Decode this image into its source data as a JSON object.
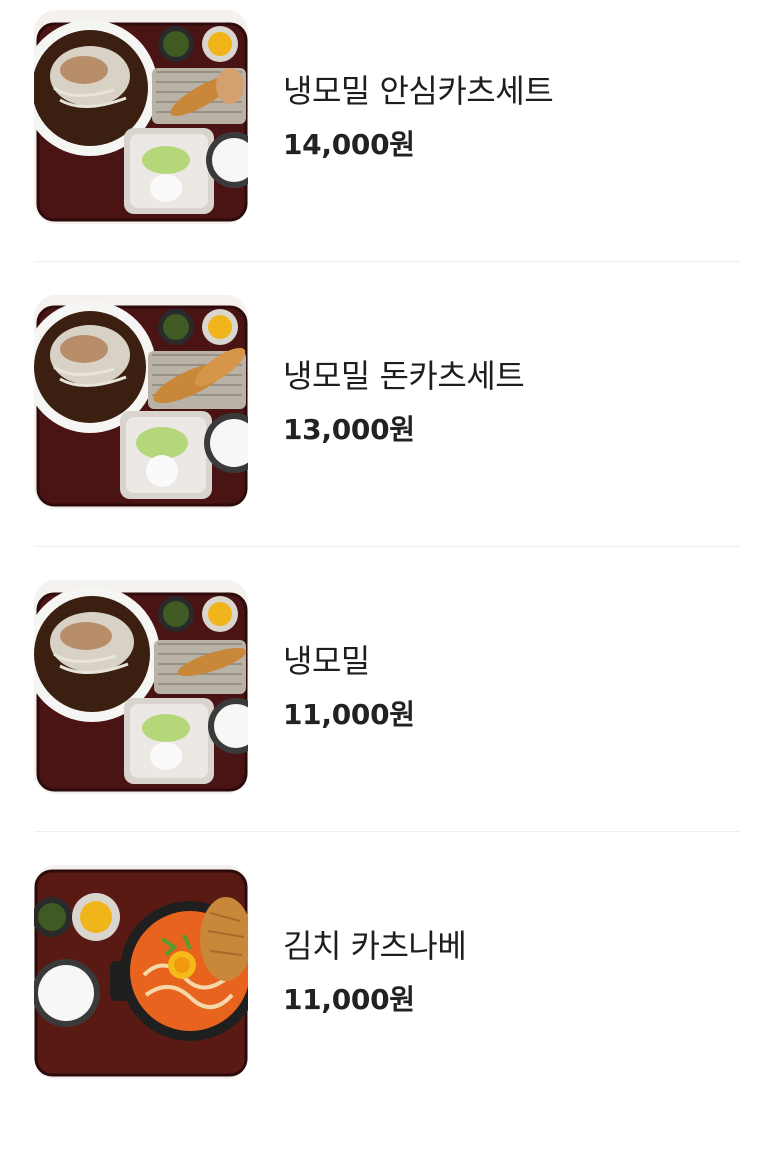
{
  "menu": {
    "items": [
      {
        "name": "냉모밀 안심카츠세트",
        "price": "14,000원",
        "image_icon": "naengmomil-ansim-katsu-set-photo"
      },
      {
        "name": "냉모밀 돈카츠세트",
        "price": "13,000원",
        "image_icon": "naengmomil-donkatsu-set-photo"
      },
      {
        "name": "냉모밀",
        "price": "11,000원",
        "image_icon": "naengmomil-photo"
      },
      {
        "name": "김치 카츠나베",
        "price": "11,000원",
        "image_icon": "kimchi-katsunabe-photo"
      }
    ]
  },
  "colors": {
    "tray": "#4a1414",
    "broth": "#3b1f10",
    "katsu": "#c9873a",
    "divider": "#eeeeee"
  }
}
